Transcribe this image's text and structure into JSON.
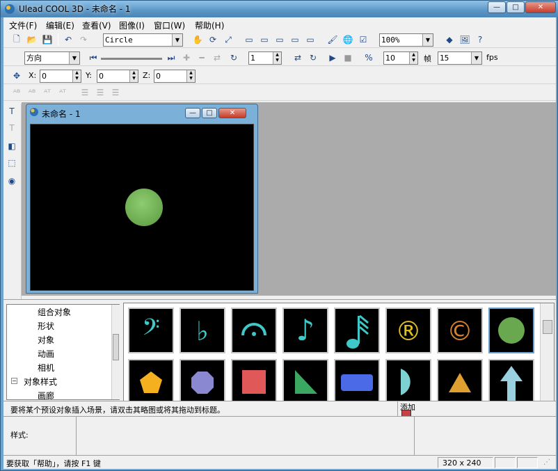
{
  "window": {
    "title": "Ulead COOL 3D - 未命名 - 1",
    "min_label": "—",
    "max_label": "□",
    "close_label": "✕"
  },
  "menu": {
    "items": [
      "文件(F)",
      "编辑(E)",
      "查看(V)",
      "图像(I)",
      "窗口(W)",
      "帮助(H)"
    ]
  },
  "toolbar": {
    "object_combo": "Circle",
    "zoom_combo": "100%",
    "direction_combo": "方向",
    "frame_spin": "1",
    "frames_count": "10",
    "frames_label": "帧",
    "fps_value": "15",
    "fps_label": "fps",
    "x_label": "X:",
    "x_value": "0",
    "y_label": "Y:",
    "y_value": "0",
    "z_label": "Z:",
    "z_value": "0"
  },
  "document": {
    "title": "未命名 - 1"
  },
  "tree": {
    "items": [
      "组合对象",
      "形状",
      "对象",
      "动画",
      "相机",
      "对象样式",
      "画廊"
    ]
  },
  "gallery": {
    "row1": [
      "bass-clef",
      "flat-sign",
      "fermata",
      "eighth-note",
      "sixteenth-note",
      "registered",
      "copyright",
      "circle"
    ],
    "row2": [
      "pentagon",
      "octagon",
      "square",
      "right-triangle",
      "rounded-rectangle",
      "half-circle",
      "triangle",
      "arrow-up"
    ],
    "row1_symbols": [
      "𝄢",
      "♭",
      "𝄐",
      "♪",
      "𝅘𝅥𝅯",
      "®",
      "©",
      ""
    ],
    "colors": {
      "cyan": "#3ec8c8",
      "yellow": "#e0c020",
      "orange": "#d8802a",
      "green": "#6aa84f",
      "pentagon": "#f5b020",
      "octagon": "#8a88d0",
      "square": "#e05858",
      "triangle_green": "#3aa860",
      "blue": "#4a6ae8",
      "half": "#7fd0d0",
      "tri_orange": "#e0a030",
      "arrow": "#9ad0e0"
    }
  },
  "hint": {
    "text": "要将某个预设对象插入场景，请双击其略图或将其拖动到标题。",
    "add_label": "添加"
  },
  "style_label": "样式:",
  "status": {
    "help_text": "要获取「帮助」，请按 F1 键",
    "size": "320 x 240"
  }
}
